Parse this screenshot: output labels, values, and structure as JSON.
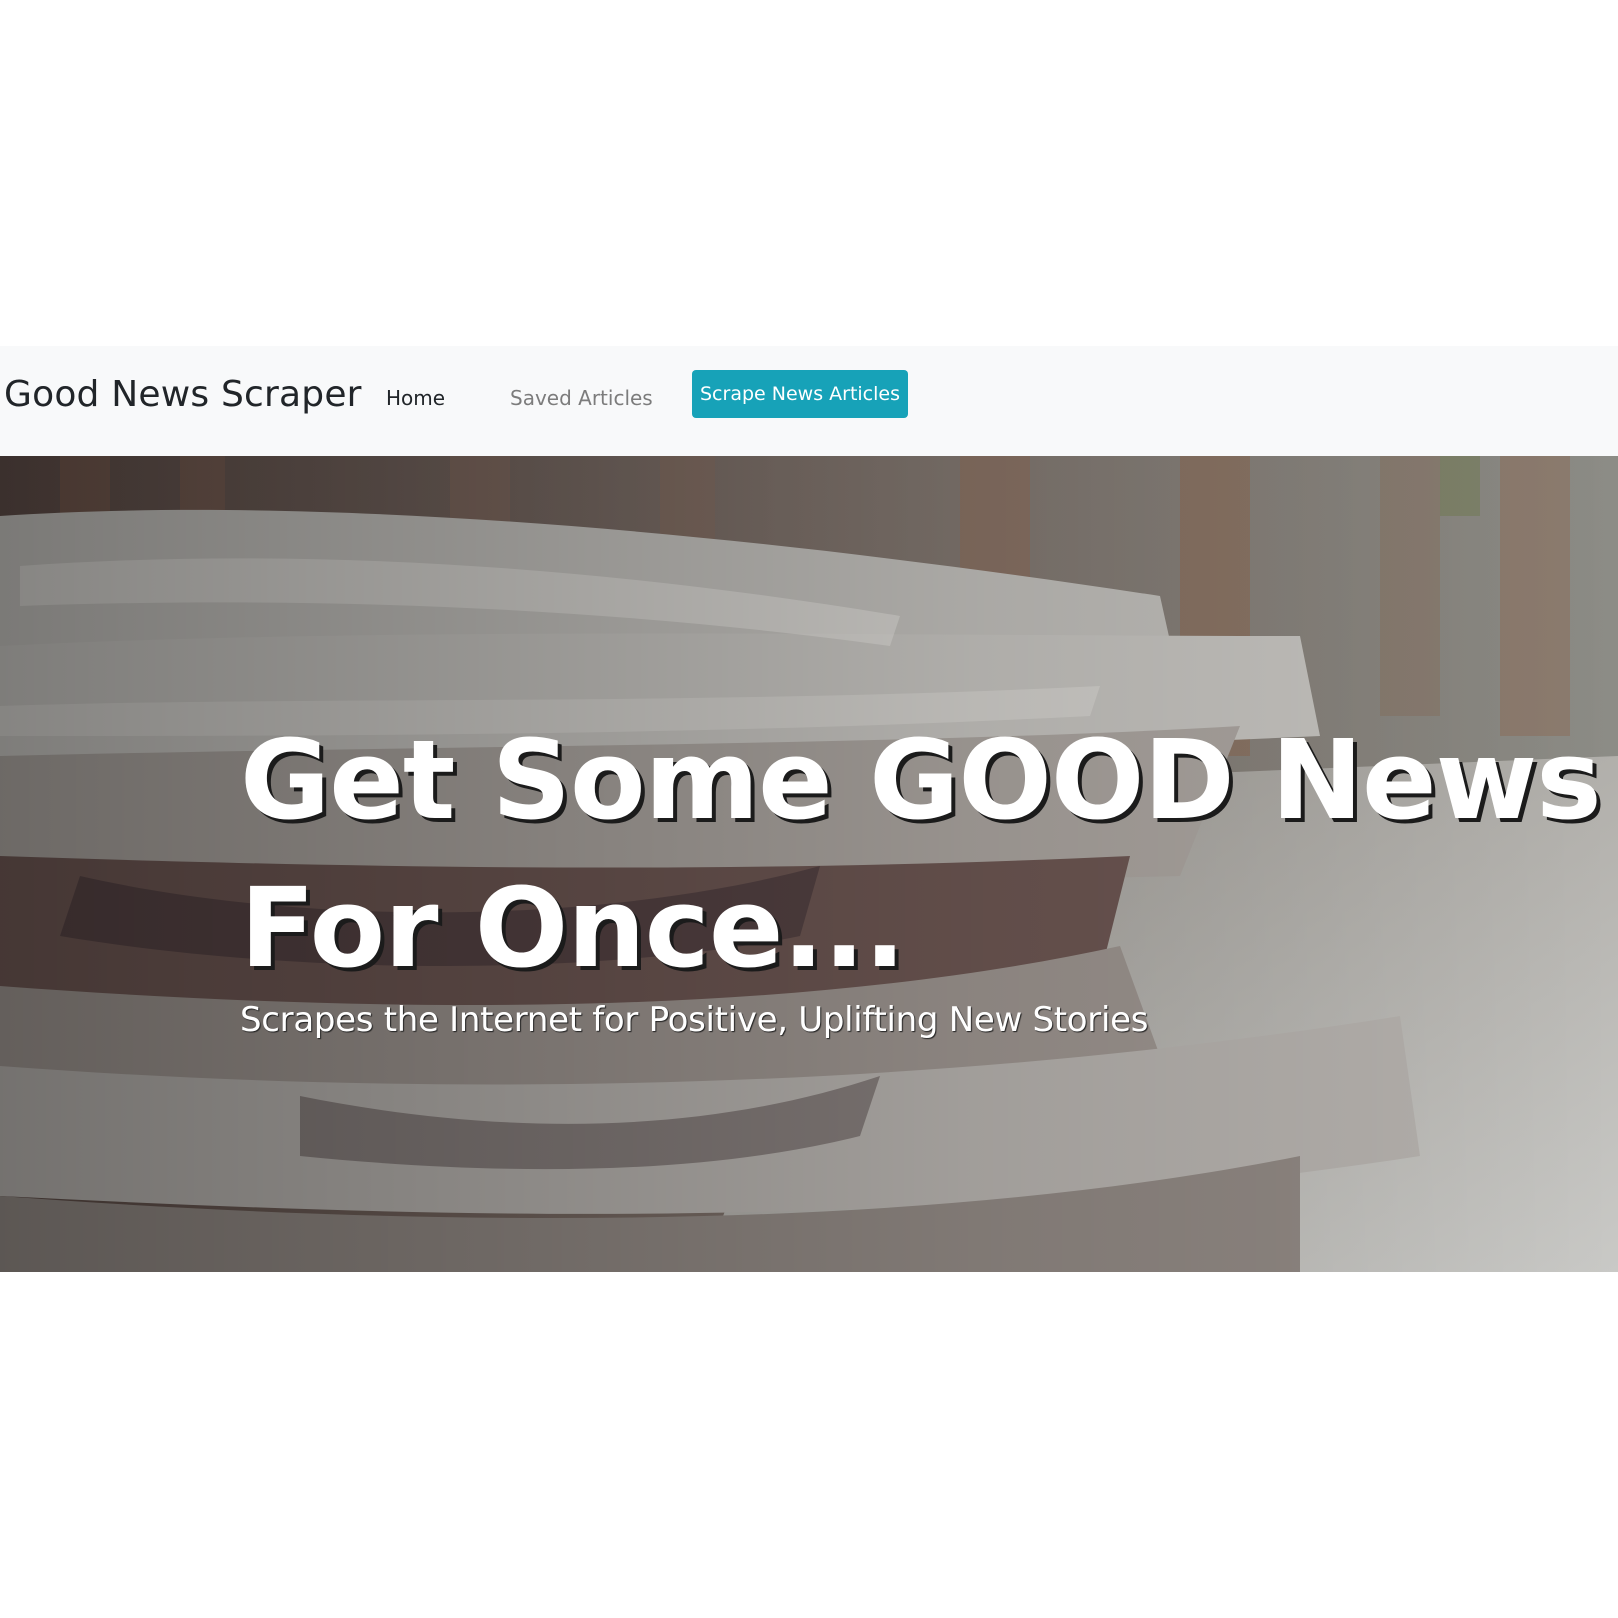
{
  "navbar": {
    "brand": "Good News Scraper",
    "links": [
      {
        "label": "Home"
      },
      {
        "label": "Saved Articles"
      }
    ],
    "scrape_button": "Scrape News Articles"
  },
  "hero": {
    "title_line1": "Get Some GOOD News",
    "title_line2": "For Once...",
    "subtitle": "Scrapes the Internet for Positive, Uplifting New Stories"
  },
  "colors": {
    "navbar_bg": "#f8f9fa",
    "button_bg": "#17a2b8",
    "text_dark": "#212529",
    "text_muted": "#7c7c7c"
  }
}
